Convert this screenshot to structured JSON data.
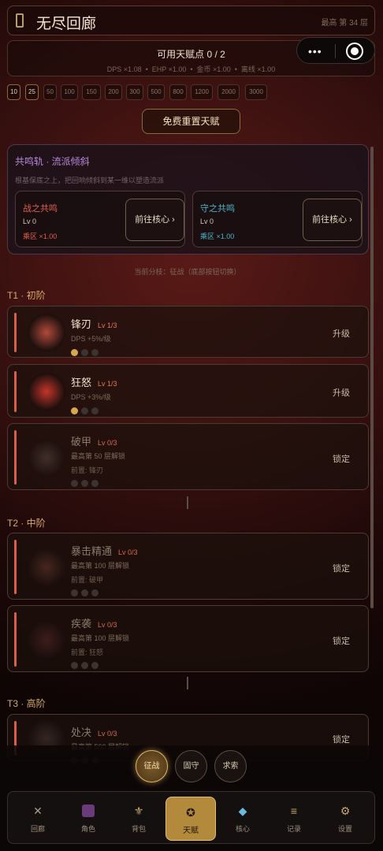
{
  "header": {
    "title": "无尽回廊",
    "best_floor": "最高 第 34 层"
  },
  "talent_points": {
    "label": "可用天赋点 0 / 2",
    "multipliers": "DPS ×1.08  •  EHP ×1.00  •  金币 ×1.00  •  离线 ×1.00"
  },
  "floor_chips": [
    "10",
    "25",
    "50",
    "100",
    "150",
    "200",
    "300",
    "500",
    "800",
    "1200",
    "2000",
    "3000"
  ],
  "reset_button": "免费重置天赋",
  "resonance": {
    "header": "共鸣轨 · 流派倾斜",
    "description": "根基保底之上，把回响倾斜到某一维以塑造流派",
    "cards": [
      {
        "name": "战之共鸣",
        "level": "Lv 0",
        "multiplier": "乘区 ×1.00",
        "button": "前往核心 ›",
        "color": "#e0604a"
      },
      {
        "name": "守之共鸣",
        "level": "Lv 0",
        "multiplier": "乘区 ×1.00",
        "button": "前往核心 ›",
        "color": "#49b7c8"
      }
    ]
  },
  "branch_text": "当前分枝：征战（底部按钮切换）",
  "tiers": [
    {
      "label": "T1 · 初阶"
    },
    {
      "label": "T2 · 中阶"
    },
    {
      "label": "T3 · 高阶"
    }
  ],
  "skills": [
    {
      "name": "锋刃",
      "level": "Lv 1/3",
      "desc": "DPS +5%/级",
      "req": "",
      "filled": 1,
      "action": "升级",
      "unlocked": true
    },
    {
      "name": "狂怒",
      "level": "Lv 1/3",
      "desc": "DPS +3%/级",
      "req": "",
      "filled": 1,
      "action": "升级",
      "unlocked": true
    },
    {
      "name": "破甲",
      "level": "Lv 0/3",
      "desc": "最高第 50 层解锁",
      "req": "前置: 锋刃",
      "filled": 0,
      "action": "锁定",
      "unlocked": false
    },
    {
      "name": "暴击精通",
      "level": "Lv 0/3",
      "desc": "最高第 100 层解锁",
      "req": "前置: 破甲",
      "filled": 0,
      "action": "锁定",
      "unlocked": false
    },
    {
      "name": "疾袭",
      "level": "Lv 0/3",
      "desc": "最高第 100 层解锁",
      "req": "前置: 狂怒",
      "filled": 0,
      "action": "锁定",
      "unlocked": false
    },
    {
      "name": "处决",
      "level": "Lv 0/3",
      "desc": "最高第 500 层解锁",
      "req": "",
      "filled": 0,
      "action": "锁定",
      "unlocked": false
    }
  ],
  "path_buttons": [
    {
      "label": "征战",
      "active": true
    },
    {
      "label": "固守",
      "active": false
    },
    {
      "label": "求索",
      "active": false
    }
  ],
  "tabs": [
    {
      "label": "回廊",
      "icon": "crossed-swords-icon",
      "active": false
    },
    {
      "label": "角色",
      "icon": "character-icon",
      "active": false
    },
    {
      "label": "背包",
      "icon": "backpack-icon",
      "active": false
    },
    {
      "label": "天赋",
      "icon": "talent-icon",
      "active": true
    },
    {
      "label": "核心",
      "icon": "core-gem-icon",
      "active": false
    },
    {
      "label": "记录",
      "icon": "scroll-icon",
      "active": false
    },
    {
      "label": "设置",
      "icon": "gear-icon",
      "active": false
    }
  ],
  "colors": {
    "accent_gold": "#d8a84c",
    "accent_red": "#d86048",
    "tier_label": "#d6a96a",
    "resonance_header": "#b68ad8"
  }
}
